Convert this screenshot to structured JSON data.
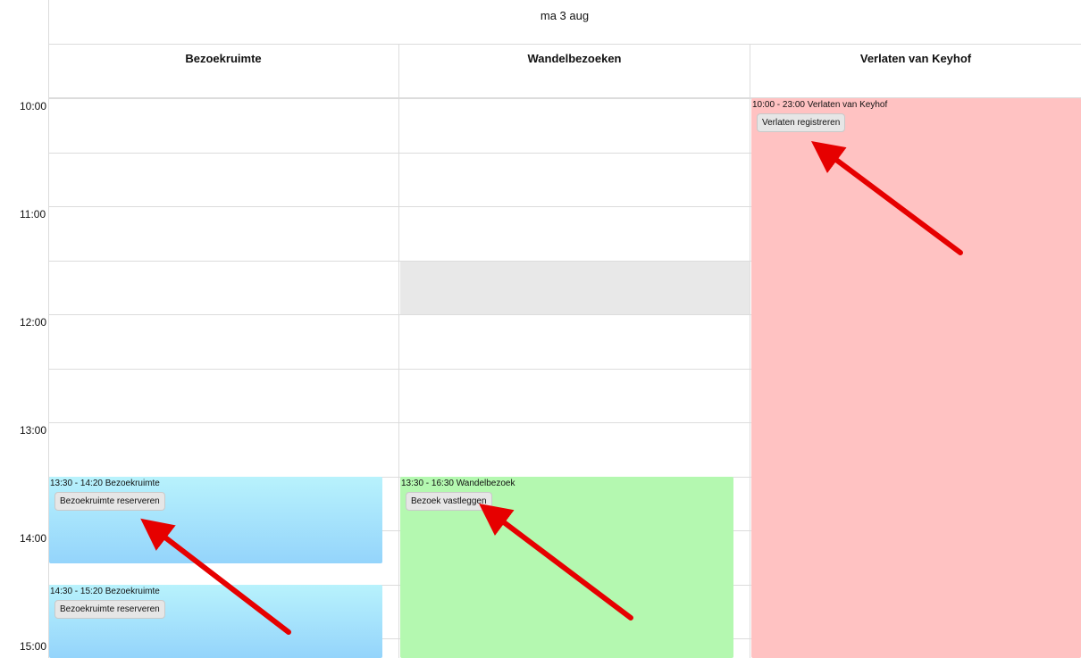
{
  "calendar": {
    "date_label": "ma 3 aug",
    "columns": [
      {
        "title": "Bezoekruimte"
      },
      {
        "title": "Wandelbezoeken"
      },
      {
        "title": "Verlaten van Keyhof"
      }
    ],
    "time_labels": [
      "10:00",
      "11:00",
      "12:00",
      "13:00",
      "14:00",
      "15:00"
    ],
    "events": {
      "bezoek_1": {
        "title": "13:30 - 14:20 Bezoekruimte",
        "button": "Bezoekruimte reserveren"
      },
      "bezoek_2": {
        "title": "14:30 - 15:20 Bezoekruimte",
        "button": "Bezoekruimte reserveren"
      },
      "wandel": {
        "title": "13:30 - 16:30 Wandelbezoek",
        "button": "Bezoek vastleggen"
      },
      "verlaten": {
        "title": "10:00 - 23:00 Verlaten van Keyhof",
        "button": "Verlaten registreren"
      }
    }
  },
  "colors": {
    "blue_event": "#a6e4fc",
    "green_event": "#b4f8b0",
    "red_event": "#ffc2c2",
    "annotation_arrow": "#e60000",
    "unavailable": "#e8e8e8"
  }
}
